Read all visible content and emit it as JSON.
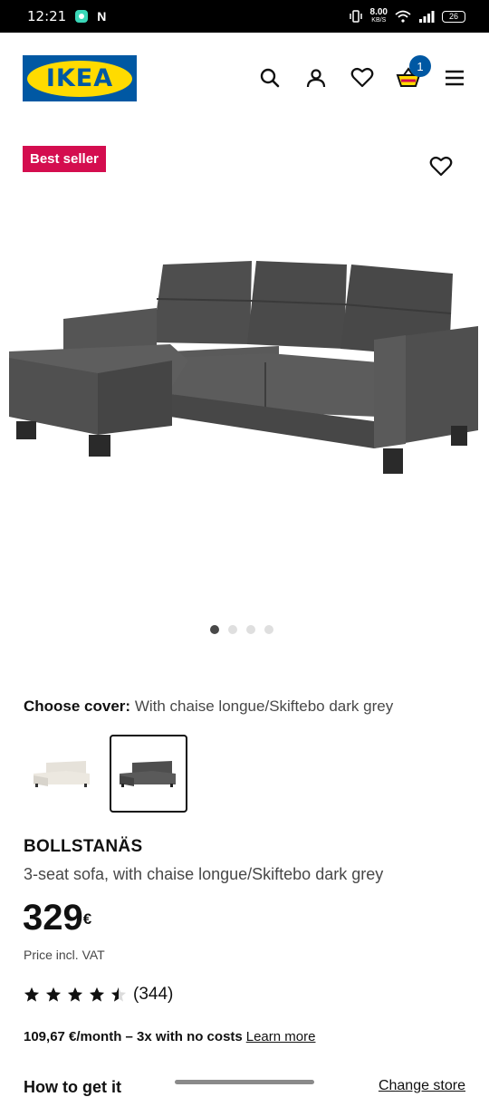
{
  "status_bar": {
    "time": "12:21",
    "net_speed": "8.00",
    "net_unit": "KB/S",
    "battery": "26"
  },
  "header": {
    "logo_text": "IKEA",
    "cart_count": "1",
    "brand_colors": {
      "blue": "#0058a3",
      "yellow": "#ffdb00"
    }
  },
  "hero": {
    "badge": "Best seller",
    "carousel_total": 4,
    "carousel_active": 1
  },
  "cover": {
    "label": "Choose cover:",
    "value": "With chaise longue/Skiftebo dark grey"
  },
  "product": {
    "name": "BOLLSTANÄS",
    "description": "3-seat sofa, with chaise longue/Skiftebo dark grey",
    "price": "329",
    "currency": "€",
    "vat_note": "Price incl. VAT",
    "rating": 4.5,
    "review_count": "(344)",
    "monthly": "109,67 €/month – 3x with no costs",
    "learn_more": "Learn more"
  },
  "footer": {
    "how_to_get": "How to get it",
    "change_store": "Change store"
  }
}
